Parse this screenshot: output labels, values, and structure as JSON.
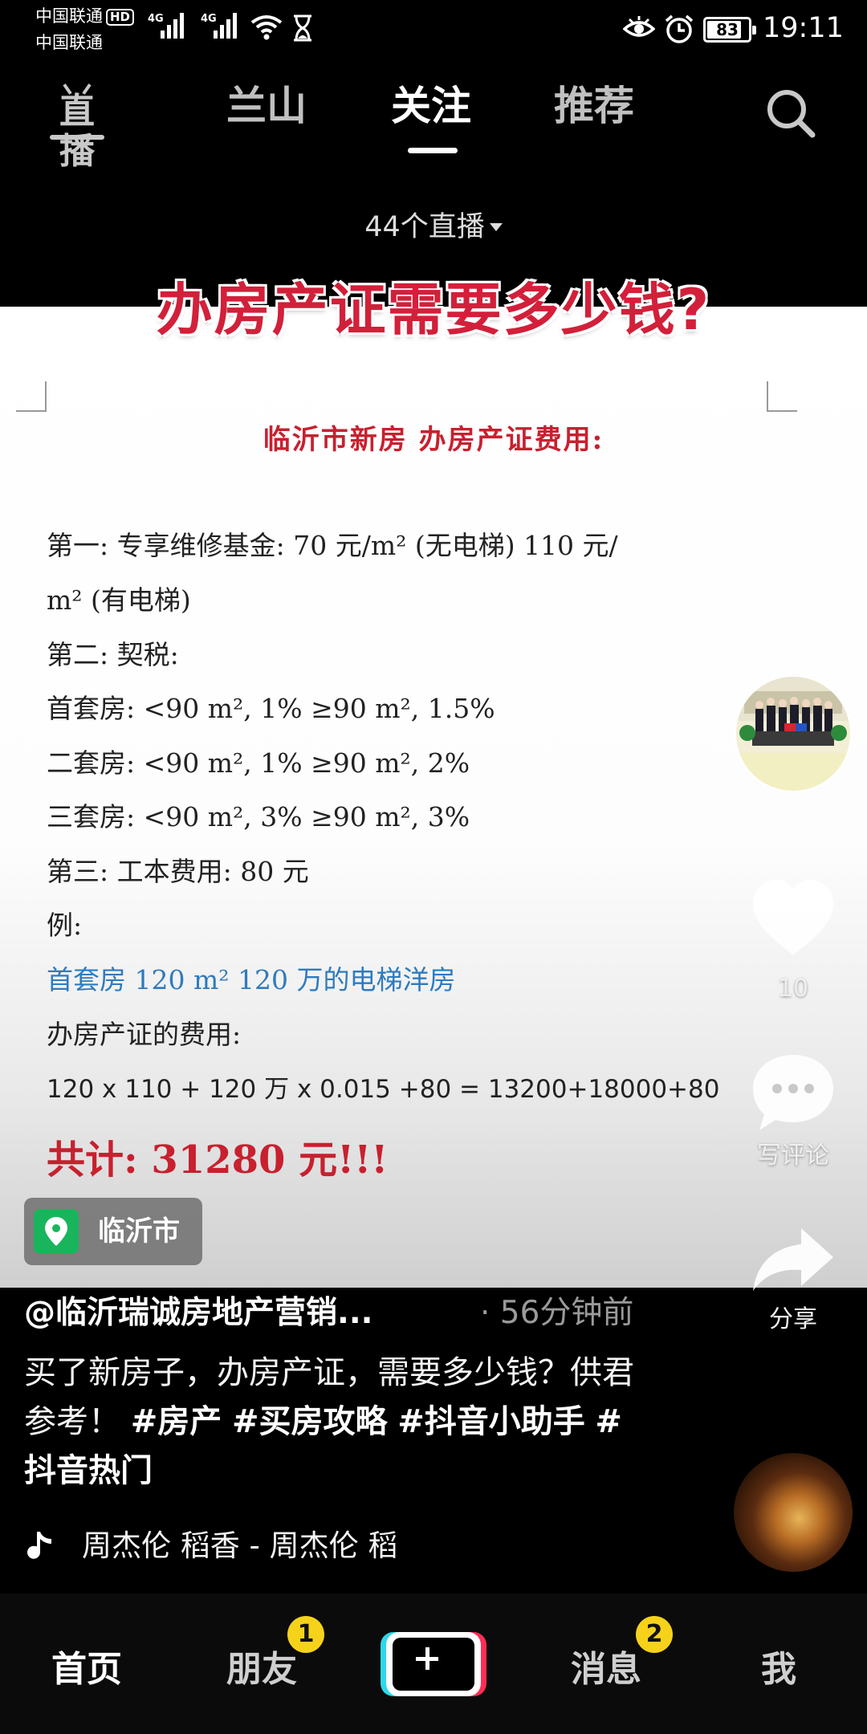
{
  "status_bar": {
    "carrier_1": "中国联通",
    "carrier_1_badge": "HD",
    "carrier_2": "中国联通",
    "network_1": "4G",
    "network_2": "4G",
    "battery": "83",
    "battery_level": 0.83,
    "time": "19:11"
  },
  "top_nav": {
    "live_label": "直播",
    "tabs": [
      {
        "label": "兰山",
        "active": false
      },
      {
        "label": "关注",
        "active": true
      },
      {
        "label": "推荐",
        "active": false
      }
    ],
    "live_count": "44个直播"
  },
  "video": {
    "headline": "办房产证需要多少钱?",
    "doc_title": "临沂市新房  办房产证费用:",
    "lines": [
      "第一: 专享维修基金: 70 元/m² (无电梯)  110 元/",
      "m² (有电梯)",
      "第二: 契税:",
      "首套房: <90 m², 1%     ≥90 m², 1.5%",
      "二套房: <90 m², 1%     ≥90 m², 2%",
      "三套房: <90 m², 3%     ≥90 m², 3%",
      "第三: 工本费用: 80 元",
      "例:",
      "首套房 120 m² 120 万的电梯洋房",
      "办房产证的费用:",
      "120 x 110 + 120 万 x 0.015 +80 = 13200+18000+80"
    ],
    "total": "共计: 31280 元!!!",
    "location": "临沂市"
  },
  "right_rail": {
    "likes": "10",
    "comment_label": "写评论",
    "share_label": "分享"
  },
  "caption": {
    "author": "@临沂瑞诚房地产营销...",
    "time": "· 56分钟前",
    "text": "买了新房子，办房产证，需要多少钱？供君参考！",
    "tags": [
      "#房产",
      "#买房攻略",
      "#抖音小助手",
      "#抖音热门"
    ],
    "music": "周杰伦   稻香 - 周杰伦   稻"
  },
  "bottom_nav": {
    "items": [
      {
        "label": "首页",
        "active": true
      },
      {
        "label": "朋友",
        "badge": "1"
      },
      {
        "label": "消息",
        "badge": "2"
      },
      {
        "label": "我"
      }
    ]
  },
  "colors": {
    "headline_red": "#d2203a",
    "doc_red": "#c8202f",
    "doc_blue": "#2f7bbd",
    "badge_yellow": "#f6d21b",
    "location_green": "#19b55c"
  }
}
